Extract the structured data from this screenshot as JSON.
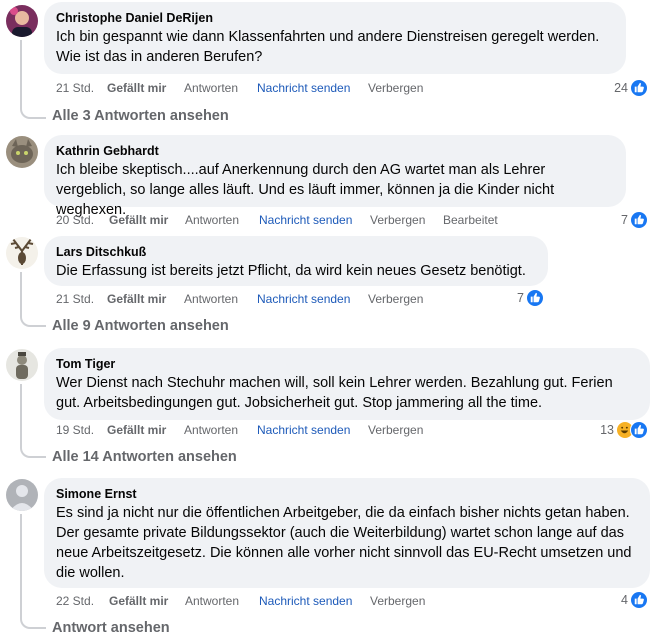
{
  "comments": [
    {
      "author": "Christophe Daniel DeRijen",
      "text": "Ich bin gespannt wie dann Klassenfahrten und andere Dienstreisen geregelt werden. Wie ist das in anderen Berufen?",
      "time": "21 Std.",
      "like_label": "Gefällt mir",
      "reply_label": "Antworten",
      "message_label": "Nachricht senden",
      "hide_label": "Verbergen",
      "reaction_count": "24",
      "reactions": [
        "like-icon"
      ],
      "view_replies": "Alle 3 Antworten ansehen"
    },
    {
      "author": "Kathrin Gebhardt",
      "text": "Ich bleibe skeptisch....auf Anerkennung durch den AG wartet man als Lehrer vergeblich, so lange alles läuft. Und es läuft immer, können ja die Kinder nicht weghexen.",
      "time": "20 Std.",
      "like_label": "Gefällt mir",
      "reply_label": "Antworten",
      "message_label": "Nachricht senden",
      "hide_label": "Verbergen",
      "edited_label": "Bearbeitet",
      "reaction_count": "7",
      "reactions": [
        "like-icon"
      ]
    },
    {
      "author": "Lars Ditschkuß",
      "text": "Die Erfassung ist bereits jetzt Pflicht, da wird kein neues Gesetz benötigt.",
      "time": "21 Std.",
      "like_label": "Gefällt mir",
      "reply_label": "Antworten",
      "message_label": "Nachricht senden",
      "hide_label": "Verbergen",
      "reaction_count": "7",
      "reactions": [
        "like-icon"
      ],
      "view_replies": "Alle 9 Antworten ansehen"
    },
    {
      "author": "Tom Tiger",
      "text": "Wer Dienst nach Stechuhr machen will, soll kein Lehrer werden. Bezahlung gut. Ferien gut. Arbeitsbedingungen gut. Jobsicherheit gut. Stop jammering all the time.",
      "time": "19 Std.",
      "like_label": "Gefällt mir",
      "reply_label": "Antworten",
      "message_label": "Nachricht senden",
      "hide_label": "Verbergen",
      "reaction_count": "13",
      "reactions": [
        "haha-icon",
        "like-icon"
      ],
      "view_replies": "Alle 14 Antworten ansehen"
    },
    {
      "author": "Simone Ernst",
      "text": "Es sind ja nicht nur die öffentlichen Arbeitgeber, die da einfach bisher nichts getan haben. Der gesamte private Bildungssektor (auch die Weiterbildung) wartet schon lange auf das neue Arbeitszeitgesetz. Die können alle vorher nicht sinnvoll das EU-Recht umsetzen und die wollen.",
      "time": "22 Std.",
      "like_label": "Gefällt mir",
      "reply_label": "Antworten",
      "message_label": "Nachricht senden",
      "hide_label": "Verbergen",
      "reaction_count": "4",
      "reactions": [
        "like-icon"
      ],
      "view_replies": "Antwort ansehen"
    }
  ],
  "colors": {
    "bubble": "#f0f2f5",
    "link_blue": "#1d5ab9",
    "meta_gray": "#65676b",
    "like_blue": "#1877f2",
    "haha_yellow": "#f7b125"
  }
}
